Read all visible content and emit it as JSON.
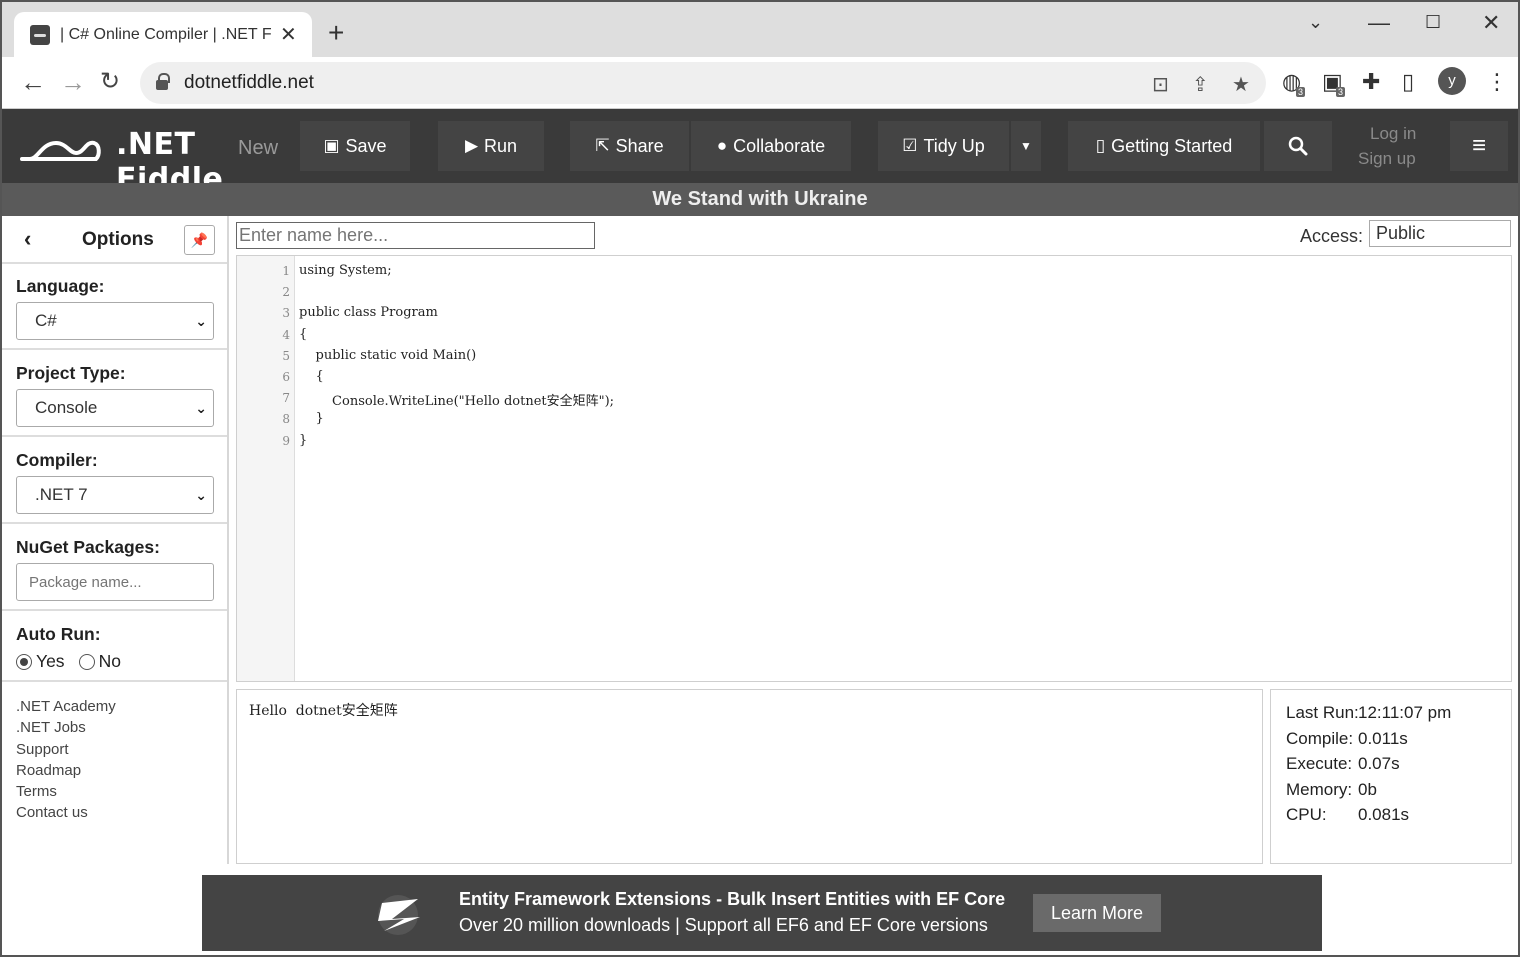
{
  "browser": {
    "tab_title": "| C# Online Compiler | .NET Fi",
    "url": "dotnetfiddle.net",
    "profile_initial": "y",
    "ext_badge_1": "3",
    "ext_badge_2": "3"
  },
  "header": {
    "logo_text": ".NET Fiddle",
    "new_label": "New",
    "buttons": {
      "save": "Save",
      "run": "Run",
      "share": "Share",
      "collaborate": "Collaborate",
      "tidy_up": "Tidy Up",
      "getting_started": "Getting Started"
    },
    "login": "Log in",
    "signup": "Sign up"
  },
  "banner": "We Stand with Ukraine",
  "sidebar": {
    "title": "Options",
    "language": {
      "label": "Language:",
      "value": "C#"
    },
    "project_type": {
      "label": "Project Type:",
      "value": "Console"
    },
    "compiler": {
      "label": "Compiler:",
      "value": ".NET 7"
    },
    "nuget": {
      "label": "NuGet Packages:",
      "placeholder": "Package name..."
    },
    "auto_run": {
      "label": "Auto Run:",
      "yes": "Yes",
      "no": "No",
      "selected": "Yes"
    },
    "links": [
      ".NET Academy",
      ".NET Jobs",
      "Support",
      "Roadmap",
      "Terms",
      "Contact us"
    ]
  },
  "editor": {
    "name_placeholder": "Enter name here...",
    "access_label": "Access:",
    "access_value": "Public",
    "lines": [
      "using System;",
      "",
      "public class Program",
      "{",
      "    public static void Main()",
      "    {",
      "        Console.WriteLine(\"Hello dotnet安全矩阵\");",
      "    }",
      "}"
    ]
  },
  "output": {
    "text": "Hello  dotnet安全矩阵"
  },
  "stats": [
    {
      "label": "Last Run:",
      "value": "12:11:07 pm"
    },
    {
      "label": "Compile:",
      "value": "0.011s"
    },
    {
      "label": "Execute:",
      "value": "0.07s"
    },
    {
      "label": "Memory:",
      "value": "0b"
    },
    {
      "label": "CPU:",
      "value": "0.081s"
    }
  ],
  "ad": {
    "title": "Entity Framework Extensions - Bulk Insert Entities with EF Core",
    "subtitle": "Over 20 million downloads | Support all EF6 and EF Core versions",
    "cta": "Learn More"
  }
}
